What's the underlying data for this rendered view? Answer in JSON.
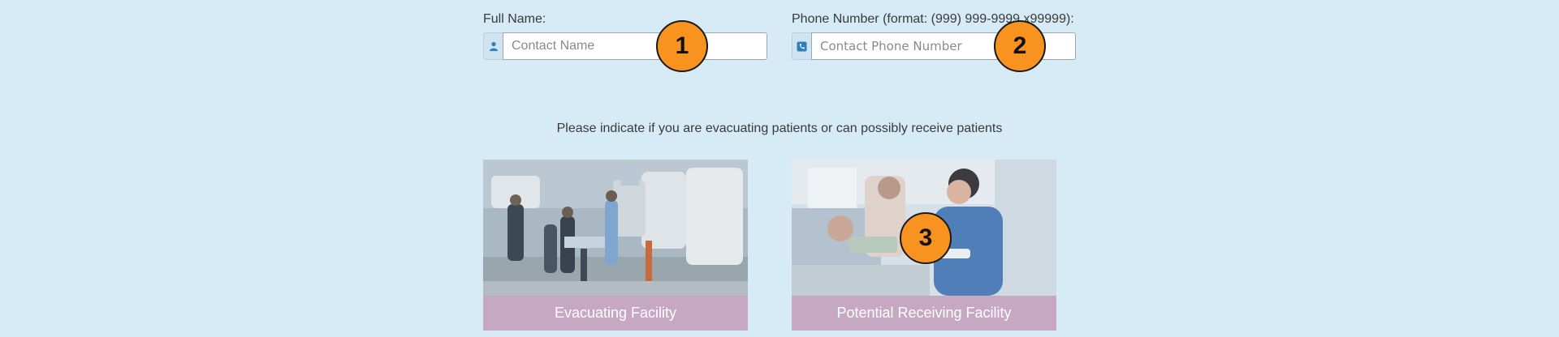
{
  "contact": {
    "name_label": "Full Name:",
    "name_placeholder": "Contact Name",
    "phone_label": "Phone Number (format: (999) 999-9999 x99999):",
    "phone_placeholder": "Contact Phone Number"
  },
  "icons": {
    "name_addon": "user-icon",
    "phone_addon": "phone-icon"
  },
  "prompt": "Please indicate if you are evacuating patients or can possibly receive patients",
  "options": [
    {
      "label": "Evacuating Facility",
      "image": "ambulance-street-scene"
    },
    {
      "label": "Potential Receiving Facility",
      "image": "nurse-with-patient"
    }
  ],
  "markers": [
    "1",
    "2",
    "3"
  ],
  "colors": {
    "background": "#d6ebf6",
    "caption": "#c6a8c2",
    "marker": "#f7931e"
  }
}
